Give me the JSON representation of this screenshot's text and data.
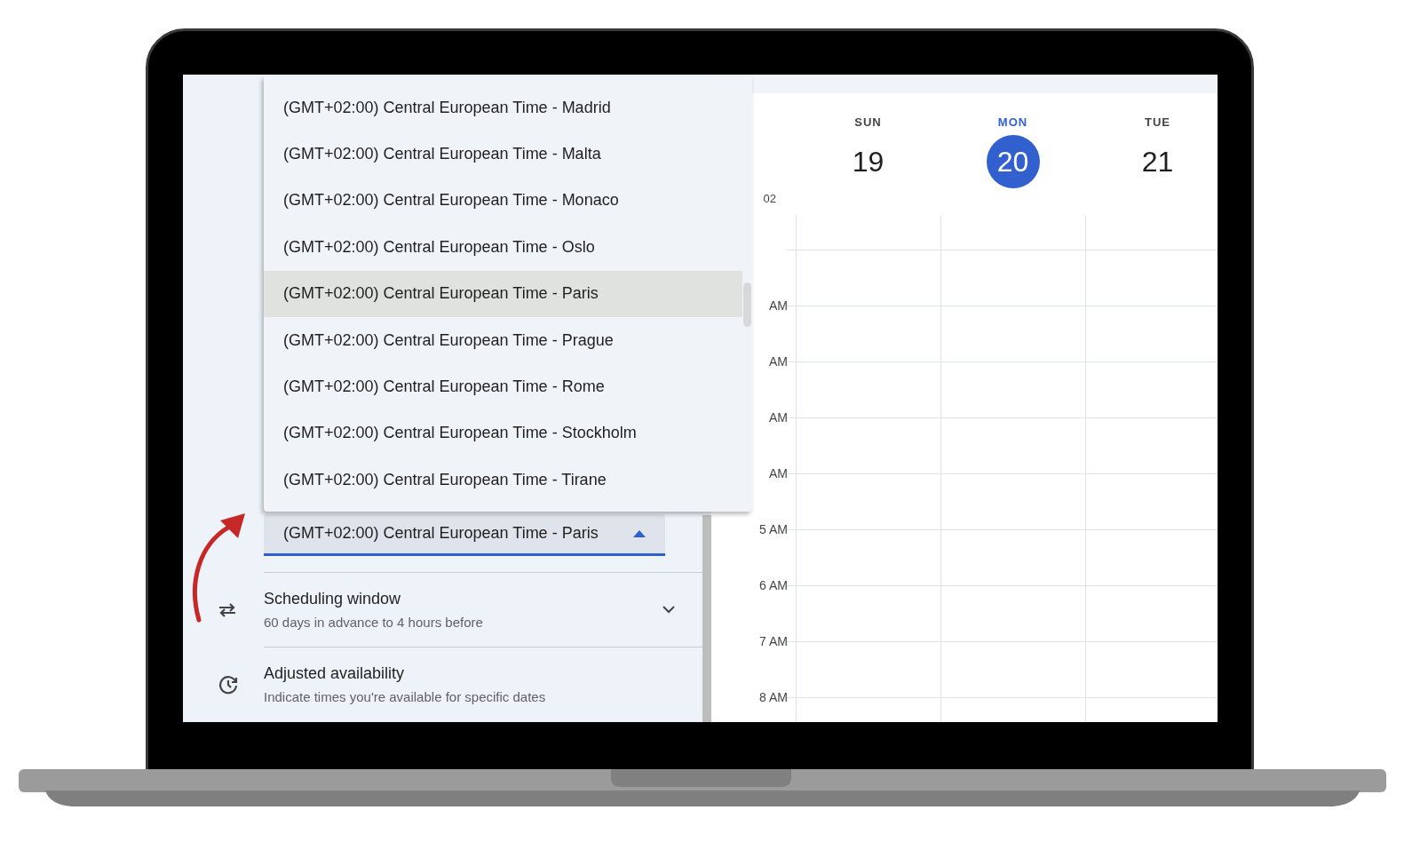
{
  "timezone_menu": {
    "options": [
      {
        "label": "(GMT+02:00) Central European Time - Madrid",
        "selected": false
      },
      {
        "label": "(GMT+02:00) Central European Time - Malta",
        "selected": false
      },
      {
        "label": "(GMT+02:00) Central European Time - Monaco",
        "selected": false
      },
      {
        "label": "(GMT+02:00) Central European Time - Oslo",
        "selected": false
      },
      {
        "label": "(GMT+02:00) Central European Time - Paris",
        "selected": true
      },
      {
        "label": "(GMT+02:00) Central European Time - Prague",
        "selected": false
      },
      {
        "label": "(GMT+02:00) Central European Time - Rome",
        "selected": false
      },
      {
        "label": "(GMT+02:00) Central European Time - Stockholm",
        "selected": false
      },
      {
        "label": "(GMT+02:00) Central European Time - Tirane",
        "selected": false
      }
    ]
  },
  "timezone_field": {
    "value": "(GMT+02:00) Central European Time - Paris",
    "expanded": true
  },
  "settings": [
    {
      "kind": "swap",
      "title": "Scheduling window",
      "subtitle": "60 days in advance to 4 hours before",
      "expandable": true
    },
    {
      "kind": "history",
      "title": "Adjusted availability",
      "subtitle": "Indicate times you're available for specific dates",
      "expandable": false
    }
  ],
  "calendar": {
    "timezone_label": "02",
    "days": [
      {
        "name": "SUN",
        "date": "19",
        "selected": false
      },
      {
        "name": "MON",
        "date": "20",
        "selected": true
      },
      {
        "name": "TUE",
        "date": "21",
        "selected": false
      }
    ],
    "time_labels": [
      "AM",
      "AM",
      "AM",
      "AM",
      "5 AM",
      "6 AM",
      "7 AM",
      "8 AM"
    ]
  }
}
